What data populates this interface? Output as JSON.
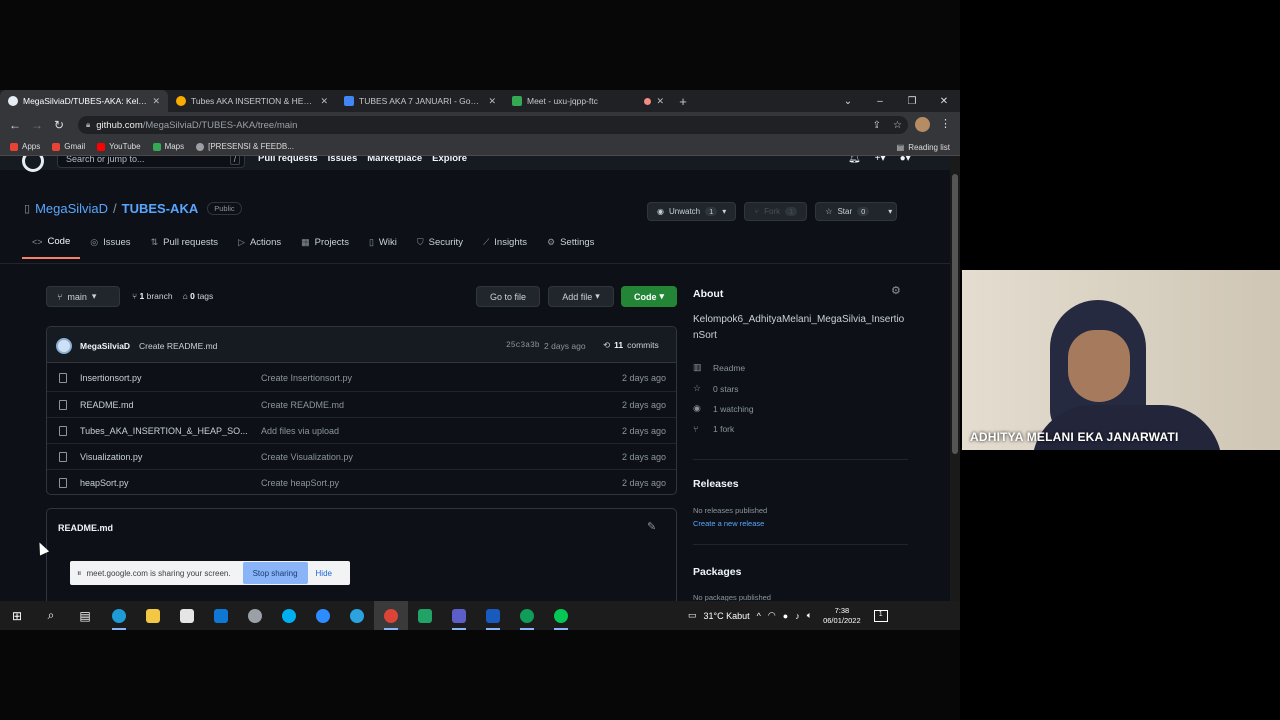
{
  "browser": {
    "tabs": [
      {
        "label": "MegaSilviaD/TUBES-AKA: Kelomp",
        "favicon_color": "#e6edf3",
        "active": true
      },
      {
        "label": "Tubes AKA INSERTION & HEAP S",
        "favicon_color": "#f9ab00",
        "active": false
      },
      {
        "label": "TUBES AKA 7 JANUARI - Google",
        "favicon_color": "#4285f4",
        "active": false
      },
      {
        "label": "Meet - uxu-jqpp-ftc",
        "favicon_color": "#34a853",
        "active": false
      }
    ],
    "url_host": "github.com",
    "url_path": "/MegaSilviaD/TUBES-AKA/tree/main",
    "bookmarks": [
      {
        "label": "Apps",
        "color": "#ea4335"
      },
      {
        "label": "Gmail",
        "color": "#ea4335"
      },
      {
        "label": "YouTube",
        "color": "#ff0000"
      },
      {
        "label": "Maps",
        "color": "#34a853"
      },
      {
        "label": "[PRESENSI & FEEDB...",
        "color": "#9aa0a6"
      }
    ],
    "reading_list": "Reading list"
  },
  "github": {
    "search_placeholder": "Search or jump to...",
    "search_shortcut": "/",
    "nav": [
      "Pull requests",
      "Issues",
      "Marketplace",
      "Explore"
    ],
    "repo_owner": "MegaSilviaD",
    "repo_sep": "/",
    "repo_name": "TUBES-AKA",
    "visibility": "Public",
    "unwatch_label": "Unwatch",
    "unwatch_count": "1",
    "fork_label": "Fork",
    "fork_count": "1",
    "star_label": "Star",
    "star_count": "0",
    "tabs": [
      {
        "label": "Code",
        "icon": "<>"
      },
      {
        "label": "Issues",
        "icon": "◎"
      },
      {
        "label": "Pull requests",
        "icon": "⇅"
      },
      {
        "label": "Actions",
        "icon": "▷"
      },
      {
        "label": "Projects",
        "icon": "▦"
      },
      {
        "label": "Wiki",
        "icon": "▯"
      },
      {
        "label": "Security",
        "icon": "⛉"
      },
      {
        "label": "Insights",
        "icon": "⟋"
      },
      {
        "label": "Settings",
        "icon": "⚙"
      }
    ],
    "branch": "main",
    "branch_count": "1",
    "branch_word": "branch",
    "tag_count": "0",
    "tag_word": "tags",
    "goto_file": "Go to file",
    "add_file": "Add file",
    "code_btn": "Code",
    "commit": {
      "author": "MegaSilviaD",
      "message": "Create README.md",
      "sha": "25c3a3b",
      "age": "2 days ago",
      "count": "11",
      "count_word": "commits"
    },
    "files": [
      {
        "name": "Insertionsort.py",
        "message": "Create Insertionsort.py",
        "age": "2 days ago"
      },
      {
        "name": "README.md",
        "message": "Create README.md",
        "age": "2 days ago"
      },
      {
        "name": "Tubes_AKA_INSERTION_&_HEAP_SO...",
        "message": "Add files via upload",
        "age": "2 days ago"
      },
      {
        "name": "Visualization.py",
        "message": "Create Visualization.py",
        "age": "2 days ago"
      },
      {
        "name": "heapSort.py",
        "message": "Create heapSort.py",
        "age": "2 days ago"
      }
    ],
    "readme_title": "README.md",
    "about_title": "About",
    "about_desc": "Kelompok6_AdhityaMelani_MegaSilvia_InsertionSort",
    "about_items": [
      {
        "icon": "▥",
        "label": "Readme"
      },
      {
        "icon": "☆",
        "label": "0 stars"
      },
      {
        "icon": "◉",
        "label": "1 watching"
      },
      {
        "icon": "⑂",
        "label": "1 fork"
      }
    ],
    "releases_title": "Releases",
    "releases_none": "No releases published",
    "releases_link": "Create a new release",
    "packages_title": "Packages",
    "packages_none": "No packages published"
  },
  "share_bar": {
    "text": "meet.google.com is sharing your screen.",
    "stop": "Stop sharing",
    "hide": "Hide"
  },
  "taskbar": {
    "weather": "31°C  Kabut",
    "time": "7:38",
    "date": "06/01/2022",
    "notifications": "1"
  },
  "webcam": {
    "participant_name": "ADHITYA MELANI EKA JANARWATI"
  }
}
